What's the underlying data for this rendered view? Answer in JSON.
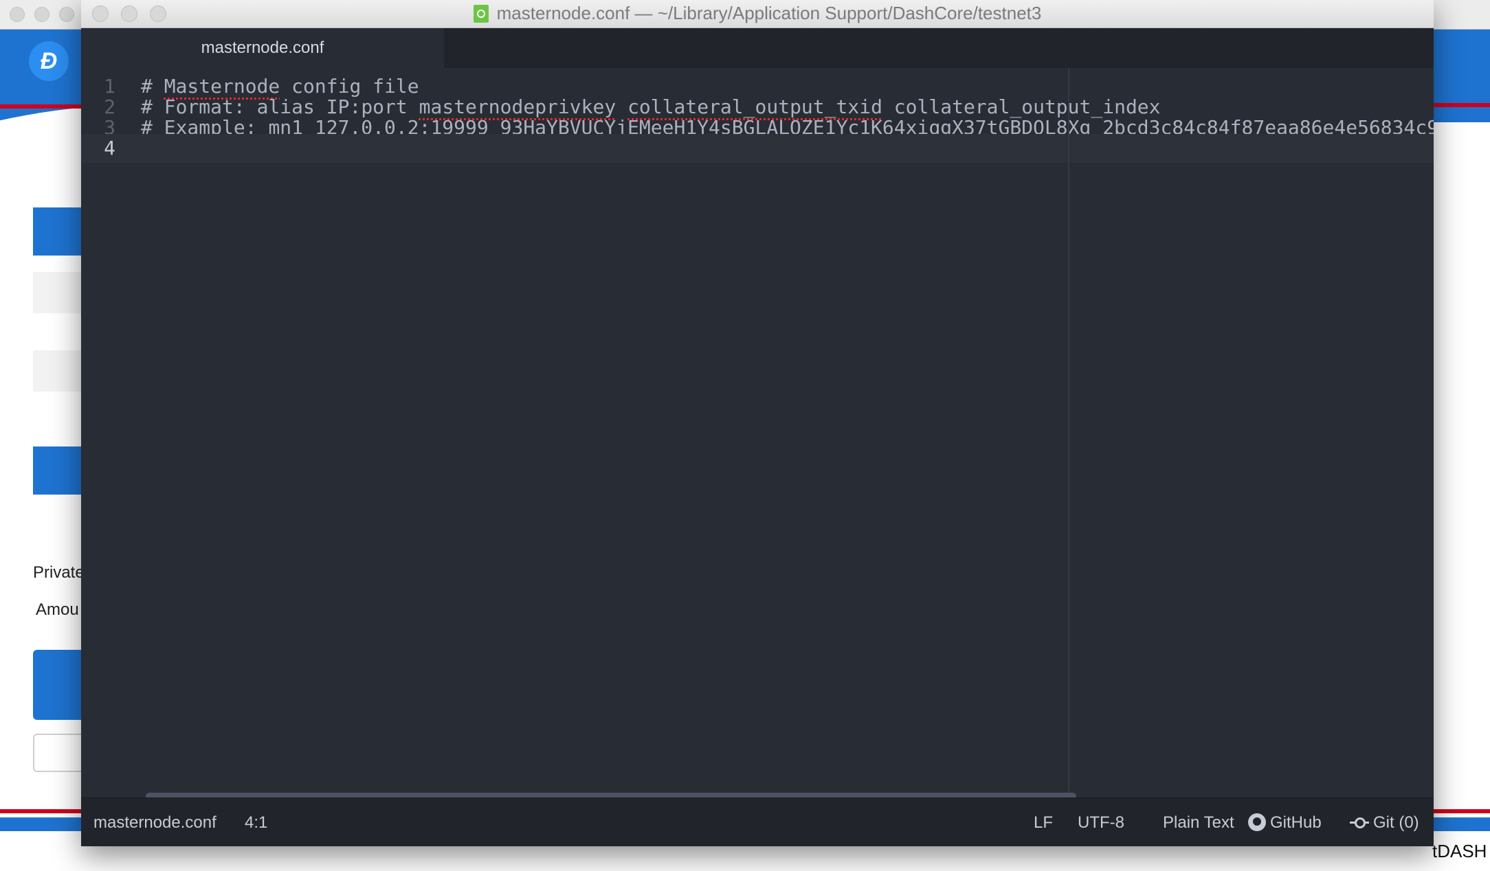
{
  "window_title": "masternode.conf — ~/Library/Application Support/DashCore/testnet3",
  "tab": {
    "label": "masternode.conf"
  },
  "editor": {
    "lines": [
      {
        "number": "1",
        "text": "# Masternode config file"
      },
      {
        "number": "2",
        "text": "# Format: alias IP:port masternodeprivkey collateral_output_txid collateral_output_index"
      },
      {
        "number": "3",
        "text": "# Example: mn1 127.0.0.2:19999 93HaYBVUCYjEMeeH1Y4sBGLALQZE1Yc1K64xiqgX37tGBDQL8Xg 2bcd3c84c84f87eaa86e4e56834c9"
      },
      {
        "number": "4",
        "text": ""
      }
    ],
    "spell_flagged_words": [
      "Masternode",
      "masternodeprivkey",
      "collateral_output_txid",
      "mn1",
      "93HaYBVUCYjEMeeH1Y4sBGLALQZE1Yc1K64xiqgX37tGBDQL8Xg",
      "2bcd3c84c84f87eaa86e4e56834c9"
    ],
    "active_line": 4
  },
  "statusbar": {
    "file_name": "masternode.conf",
    "cursor_position": "4:1",
    "line_ending": "LF",
    "encoding": "UTF-8",
    "grammar": "Plain Text",
    "github_label": "GitHub",
    "git_label": "Git (0)"
  },
  "background_app": {
    "label_private": "Private",
    "label_amount": "Amou",
    "unit": "tDASH",
    "logo_glyph": "Đ"
  },
  "colors": {
    "editor_bg": "#282c34",
    "tabbar_bg": "#21252b",
    "text": "#abb2bf",
    "line_number": "#5c6370",
    "spell_error": "#e02c2c",
    "dash_blue": "#1e73d0"
  }
}
